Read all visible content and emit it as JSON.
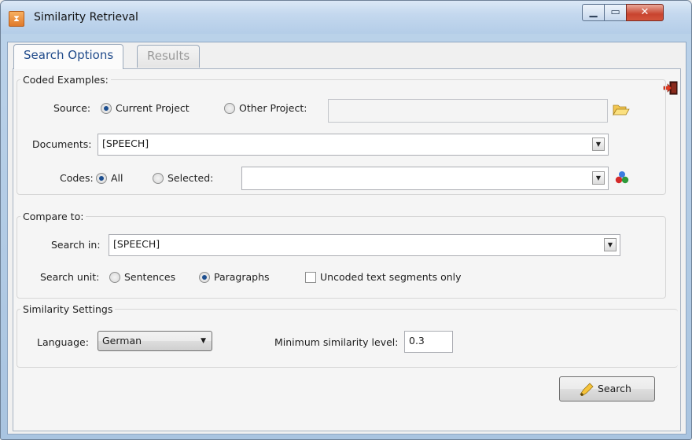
{
  "window": {
    "title": "Similarity Retrieval",
    "app_icon": "app-icon"
  },
  "tabs": [
    {
      "label": "Search Options",
      "active": true
    },
    {
      "label": "Results",
      "active": false
    }
  ],
  "coded_examples": {
    "legend": "Coded Examples:",
    "source_label": "Source:",
    "source_current": "Current Project",
    "source_other": "Other Project:",
    "source_selected": "current",
    "other_project_value": "",
    "documents_label": "Documents:",
    "documents_value": "[SPEECH]",
    "codes_label": "Codes:",
    "codes_all": "All",
    "codes_selected": "Selected:",
    "codes_choice": "all",
    "selected_codes_value": ""
  },
  "compare_to": {
    "legend": "Compare to:",
    "search_in_label": "Search in:",
    "search_in_value": "[SPEECH]",
    "search_unit_label": "Search unit:",
    "unit_sentences": "Sentences",
    "unit_paragraphs": "Paragraphs",
    "unit_selected": "paragraphs",
    "uncoded_label": "Uncoded text segments only",
    "uncoded_checked": false
  },
  "similarity_settings": {
    "legend": "Similarity Settings",
    "language_label": "Language:",
    "language_value": "German",
    "min_level_label": "Minimum similarity level:",
    "min_level_value": "0.3"
  },
  "actions": {
    "search_button": "Search"
  },
  "colors": {
    "accent": "#1c4e8f",
    "title_bar": "#c4d8ee",
    "close_button": "#c8442f"
  }
}
